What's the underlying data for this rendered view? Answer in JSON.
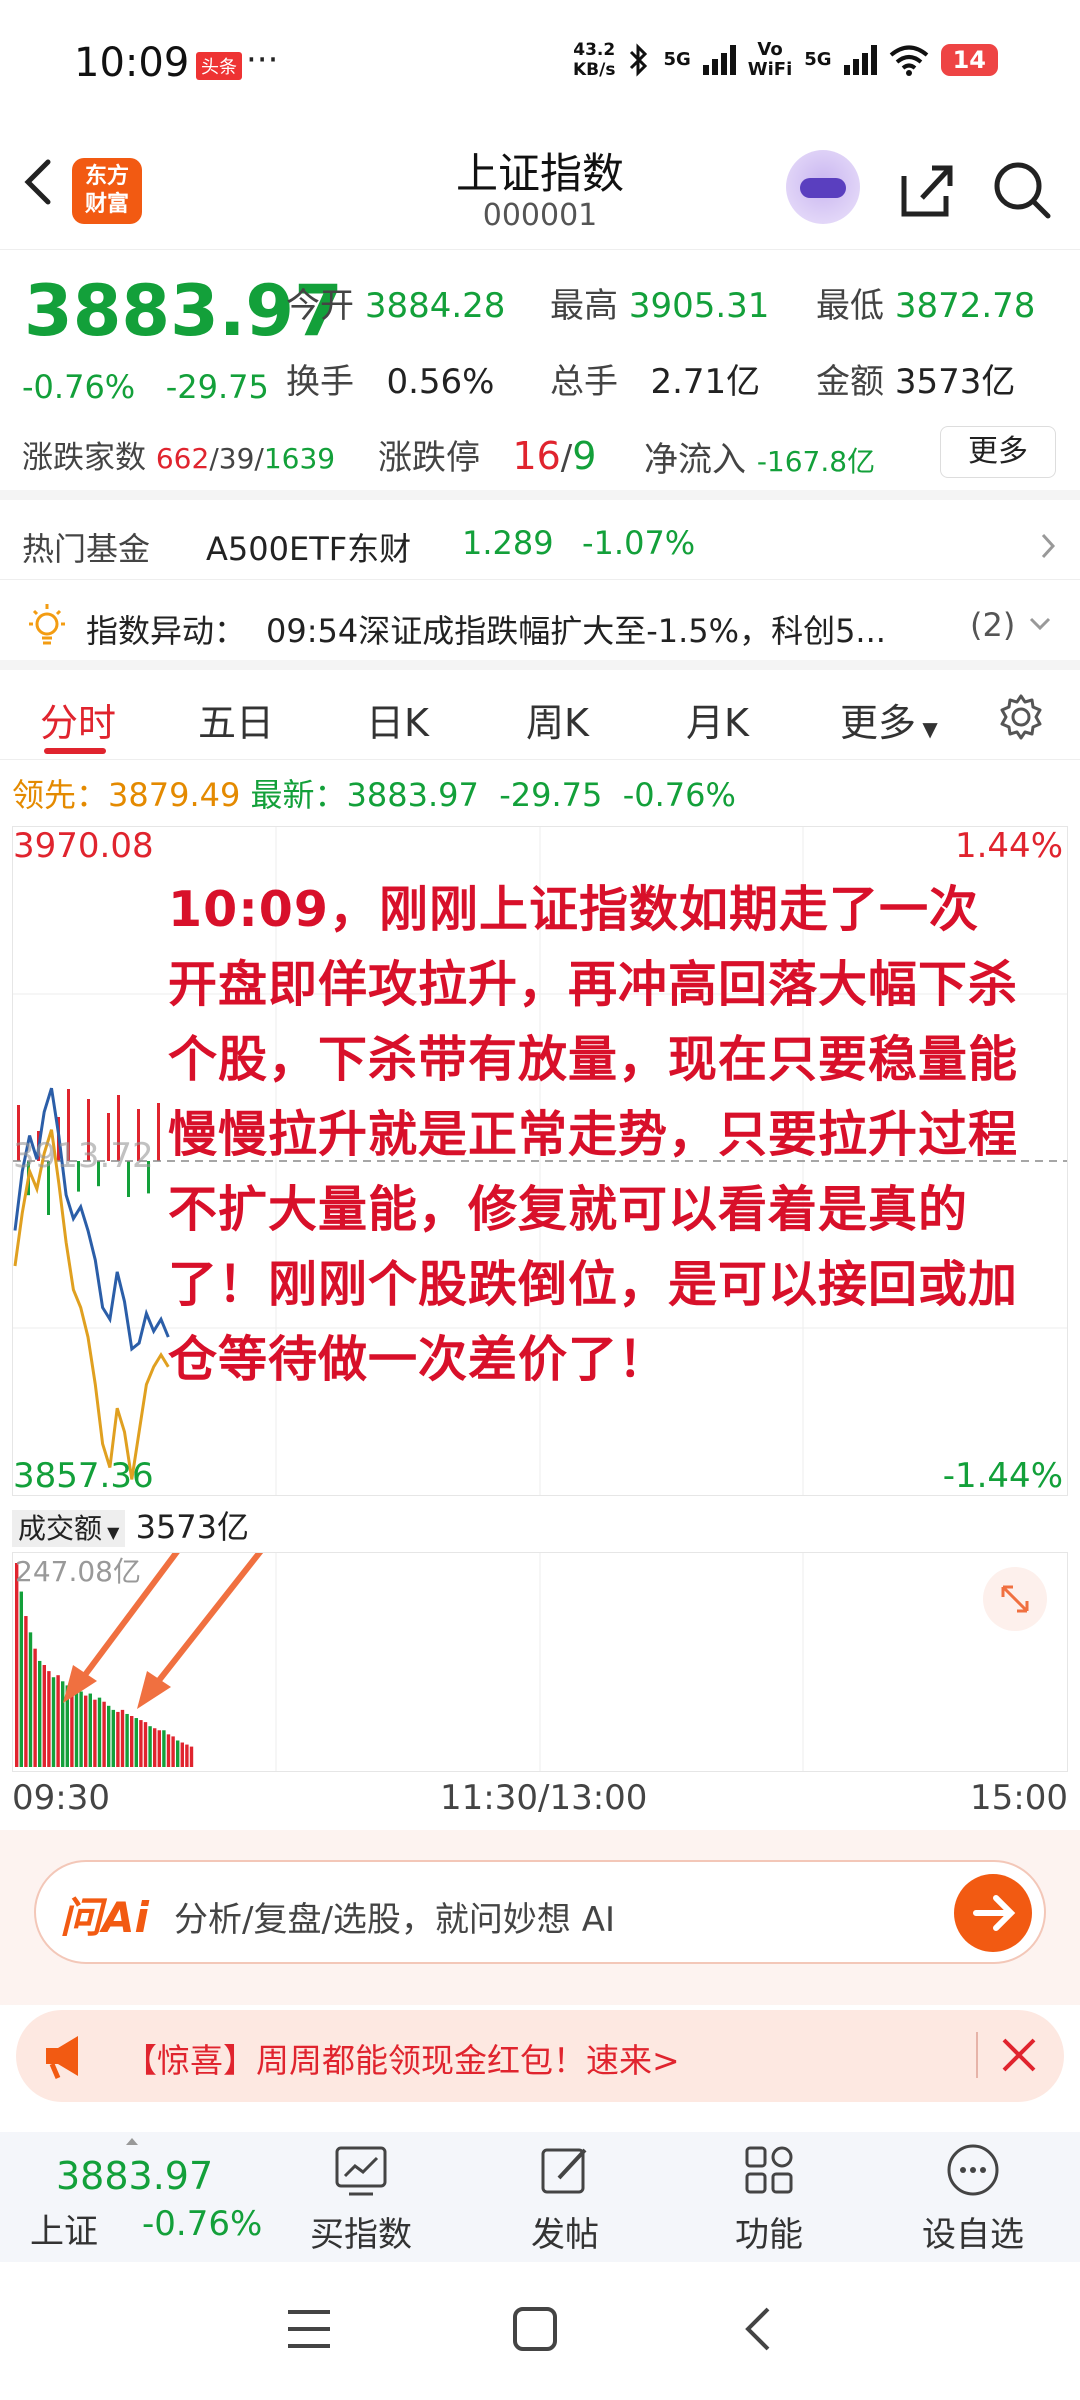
{
  "status_bar": {
    "time": "10:09",
    "badge": "头条",
    "dots": "···",
    "speed_value": "43.2",
    "speed_unit": "KB/s",
    "network1": "5G",
    "vowifi_top": "Vo",
    "vowifi_bottom": "WiFi",
    "network2": "5G",
    "battery": "14"
  },
  "header": {
    "logo_line1": "东方",
    "logo_line2": "财富",
    "title": "上证指数",
    "code": "000001"
  },
  "quote": {
    "price": "3883.97",
    "change_pct": "-0.76%",
    "change": "-29.75",
    "open_label": "今开",
    "open": "3884.28",
    "high_label": "最高",
    "high": "3905.31",
    "low_label": "最低",
    "low": "3872.78",
    "turnover_label": "换手",
    "turnover": "0.56%",
    "volume_label": "总手",
    "volume": "2.71亿",
    "amount_label": "金额",
    "amount": "3573亿",
    "breadth_label": "涨跌家数",
    "up_count": "662",
    "flat_count": "39",
    "down_count": "1639",
    "limit_label": "涨跌停",
    "limit_up": "16",
    "limit_down": "9",
    "net_inflow_label": "净流入",
    "net_inflow": "-167.8亿",
    "more": "更多"
  },
  "fund_bar": {
    "label": "热门基金",
    "name": "A500ETF东财",
    "price": "1.289",
    "change": "-1.07%"
  },
  "alert_bar": {
    "label": "指数异动：",
    "text": "09:54深证成指跌幅扩大至-1.5%，科创5...",
    "count": "(2)"
  },
  "tabs": [
    {
      "label": "分时"
    },
    {
      "label": "五日"
    },
    {
      "label": "日K"
    },
    {
      "label": "周K"
    },
    {
      "label": "月K"
    },
    {
      "label": "更多"
    }
  ],
  "lead_line": {
    "lead_label": "领先：",
    "lead_value": "3879.49",
    "latest_label": "最新：",
    "latest_value": "3883.97",
    "change": "-29.75",
    "change_pct": "-0.76%"
  },
  "chart_data": {
    "type": "line",
    "y_max": "3970.08",
    "y_min": "3857.36",
    "y_mid": "3913.72",
    "pct_max": "1.44%",
    "pct_min": "-1.44%",
    "x_ticks": [
      "09:30",
      "11:30/13:00",
      "15:00"
    ],
    "ylim": [
      3857.36,
      3970.08
    ],
    "prev_close": 3913.72,
    "series": [
      {
        "values": [
          3902,
          3912,
          3918,
          3914,
          3922,
          3926,
          3918,
          3908,
          3904,
          3906,
          3902,
          3897,
          3889,
          3887,
          3895,
          3890,
          3882,
          3883,
          3888,
          3885,
          3887,
          3884
        ]
      },
      {
        "values": [
          3896,
          3905,
          3912,
          3909,
          3915,
          3919,
          3910,
          3900,
          3892,
          3889,
          3884,
          3876,
          3866,
          3862,
          3872,
          3868,
          3860,
          3868,
          3876,
          3879,
          3881,
          3879
        ]
      }
    ],
    "colors": {
      "price": "#2b5ea8",
      "average": "#e0a020",
      "up": "#e0242e",
      "down": "#13a03a"
    }
  },
  "volume_panel": {
    "label": "成交额",
    "total": "3573亿",
    "max": "247.08亿",
    "bars": [
      1.0,
      0.86,
      0.74,
      0.66,
      0.58,
      0.52,
      0.5,
      0.47,
      0.44,
      0.45,
      0.42,
      0.4,
      0.38,
      0.39,
      0.37,
      0.35,
      0.36,
      0.33,
      0.34,
      0.32,
      0.3,
      0.28,
      0.27,
      0.28,
      0.26,
      0.25,
      0.24,
      0.23,
      0.22,
      0.2,
      0.19,
      0.18,
      0.18,
      0.16,
      0.15,
      0.13,
      0.12,
      0.11,
      0.1
    ],
    "bar_up": [
      true,
      false,
      true,
      false,
      true,
      false,
      true,
      true,
      false,
      true,
      false,
      false,
      true,
      false,
      false,
      true,
      false,
      true,
      false,
      true,
      false,
      false,
      true,
      true,
      false,
      true,
      false,
      true,
      true,
      false,
      true,
      true,
      false,
      true,
      true,
      false,
      true,
      true,
      true
    ]
  },
  "overlay_text": "10:09，刚刚上证指数如期走了一次开盘即佯攻拉升，再冲高回落大幅下杀个股，下杀带有放量，现在只要稳量能慢慢拉升就是正常走势，只要拉升过程不扩大量能，修复就可以看着是真的了！刚刚个股跌倒位，是可以接回或加仓等待做一次差价了！",
  "ai_search": {
    "logo": "问Ai",
    "placeholder": "分析/复盘/选股，就问妙想 AI"
  },
  "promo": {
    "text": "【惊喜】周周都能领现金红包！速来>"
  },
  "bottom_bar": {
    "index_price": "3883.97",
    "index_name": "上证",
    "index_change": "-0.76%",
    "buy": "买指数",
    "post": "发帖",
    "features": "功能",
    "watchlist": "设自选"
  }
}
